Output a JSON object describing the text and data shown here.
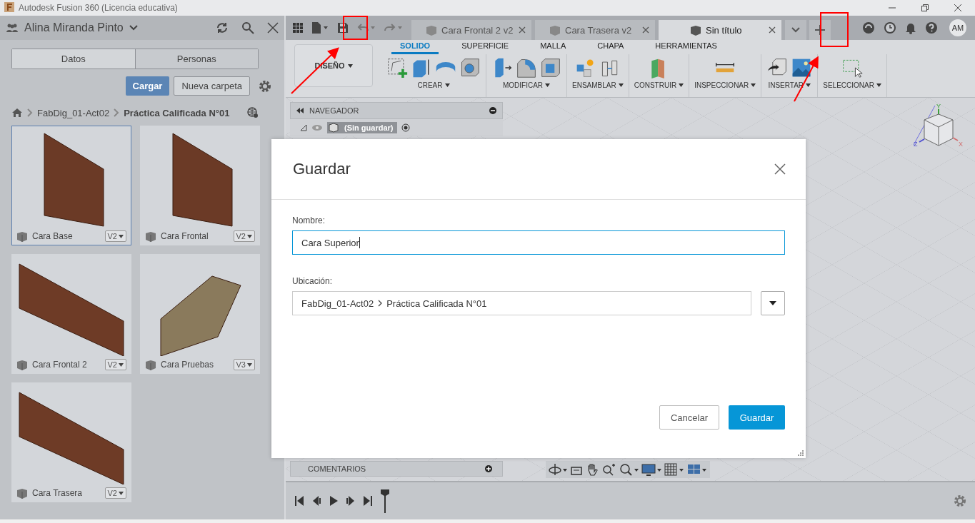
{
  "window": {
    "title": "Autodesk Fusion 360 (Licencia educativa)"
  },
  "data_panel": {
    "user": "Alina Miranda Pinto",
    "tabs": [
      {
        "label": "Datos",
        "selected": true
      },
      {
        "label": "Personas",
        "selected": false
      }
    ],
    "upload_button": "Cargar",
    "new_folder_button": "Nueva carpeta",
    "breadcrumb": [
      "FabDig_01-Act02",
      "Práctica Calificada N°01"
    ],
    "files": [
      {
        "name": "Cara Base",
        "version": "V2",
        "selected": true,
        "kind": "panel"
      },
      {
        "name": "Cara Frontal",
        "version": "V2",
        "selected": false,
        "kind": "panel"
      },
      {
        "name": "Cara Frontal 2",
        "version": "V2",
        "selected": false,
        "kind": "board"
      },
      {
        "name": "Cara Pruebas",
        "version": "V3",
        "selected": false,
        "kind": "angled"
      },
      {
        "name": "Cara Trasera",
        "version": "V2",
        "selected": false,
        "kind": "board"
      }
    ]
  },
  "document_tabs": [
    {
      "label": "Cara Frontal 2 v2",
      "selected": false
    },
    {
      "label": "Cara Trasera v2",
      "selected": false
    },
    {
      "label": "Sin título",
      "selected": true
    }
  ],
  "account": {
    "initials": "AM"
  },
  "toolbar": {
    "workspace": "DISEÑO",
    "tabs": [
      {
        "label": "SOLIDO",
        "selected": true
      },
      {
        "label": "SUPERFICIE",
        "selected": false
      },
      {
        "label": "MALLA",
        "selected": false
      },
      {
        "label": "CHAPA",
        "selected": false
      },
      {
        "label": "HERRAMIENTAS",
        "selected": false
      }
    ],
    "groups": [
      {
        "label": "CREAR",
        "tools": [
          {
            "kind": "sketch"
          },
          {
            "kind": "extrude"
          },
          {
            "kind": "revolve"
          },
          {
            "kind": "hole"
          }
        ]
      },
      {
        "label": "MODIFICAR",
        "tools": [
          {
            "kind": "pushpull"
          },
          {
            "kind": "fillet"
          },
          {
            "kind": "shell"
          }
        ]
      },
      {
        "label": "ENSAMBLAR",
        "tools": [
          {
            "kind": "component"
          },
          {
            "kind": "joint"
          }
        ]
      },
      {
        "label": "CONSTRUIR",
        "tools": [
          {
            "kind": "plane"
          }
        ]
      },
      {
        "label": "INSPECCIONAR",
        "tools": [
          {
            "kind": "measure"
          }
        ]
      },
      {
        "label": "INSERTAR",
        "tools": [
          {
            "kind": "insert"
          },
          {
            "kind": "image"
          }
        ]
      },
      {
        "label": "SELECCIONAR",
        "tools": [
          {
            "kind": "select"
          }
        ]
      }
    ]
  },
  "browser": {
    "title": "NAVEGADOR",
    "root": "(Sin guardar)"
  },
  "comments": {
    "title": "COMENTARIOS"
  },
  "view_cube": {
    "axes": [
      "Y",
      "Z",
      "X"
    ]
  },
  "save_dialog": {
    "title": "Guardar",
    "name_label": "Nombre:",
    "name_value": "Cara Superior",
    "location_label": "Ubicación:",
    "location_path": [
      "FabDig_01-Act02",
      "Práctica Calificada N°01"
    ],
    "cancel_button": "Cancelar",
    "save_button": "Guardar"
  }
}
